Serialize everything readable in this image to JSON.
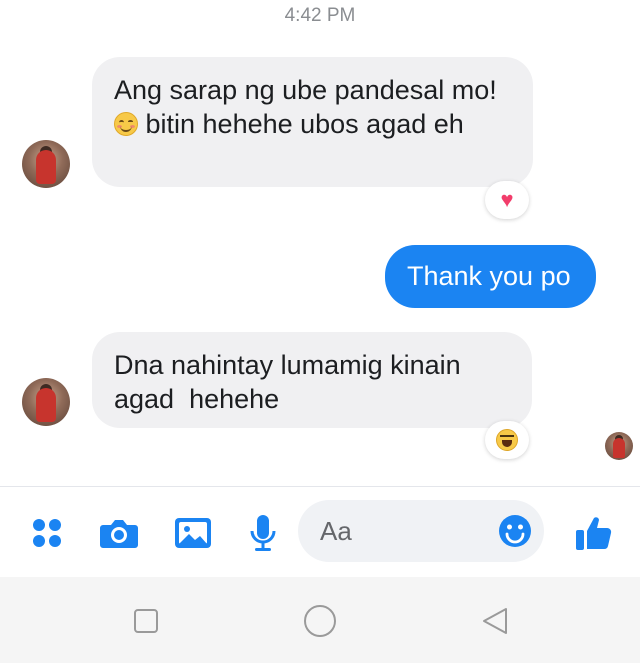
{
  "timestamp": "4:42 PM",
  "messages": [
    {
      "text_before": "Ang sarap ng ube pandesal mo!",
      "emoji": "smiling-face-icon",
      "text_after": " bitin hehehe ubos agad eh",
      "reaction": "heart-icon"
    },
    {
      "text": "Thank you po"
    },
    {
      "text": "Dna nahintay lumamig kinain agad  hehehe",
      "reaction": "laughing-face-icon"
    }
  ],
  "composer": {
    "placeholder": "Aa",
    "icons": [
      "menu-dots-icon",
      "camera-icon",
      "gallery-icon",
      "microphone-icon",
      "emoji-icon",
      "like-icon"
    ]
  },
  "navbar": {
    "icons": [
      "recent-apps-icon",
      "home-icon",
      "back-icon"
    ]
  },
  "colors": {
    "accent": "#1b84f2",
    "incoming_bubble": "#f0f0f2",
    "reaction_heart": "#f23d6b"
  }
}
